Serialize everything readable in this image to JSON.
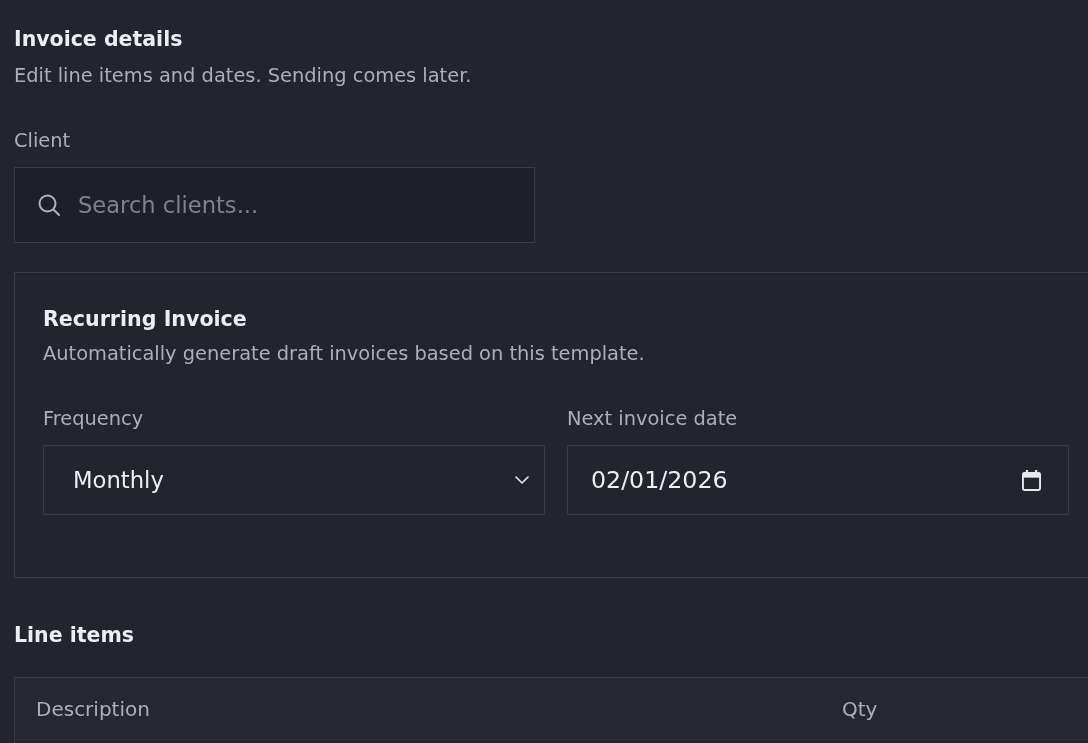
{
  "header": {
    "title": "Invoice details",
    "subtitle": "Edit line items and dates. Sending comes later."
  },
  "client": {
    "label": "Client",
    "search": {
      "placeholder": "Search clients..."
    }
  },
  "recurring": {
    "title": "Recurring Invoice",
    "description": "Automatically generate draft invoices based on this template.",
    "fields": [
      {
        "kind": "select",
        "label": "Frequency",
        "value": "Monthly"
      },
      {
        "kind": "date",
        "label": "Next invoice date",
        "value": "02/01/2026"
      }
    ]
  },
  "line_items": {
    "title": "Line items",
    "table": {
      "columns": [
        "Description",
        "Qty"
      ]
    }
  }
}
